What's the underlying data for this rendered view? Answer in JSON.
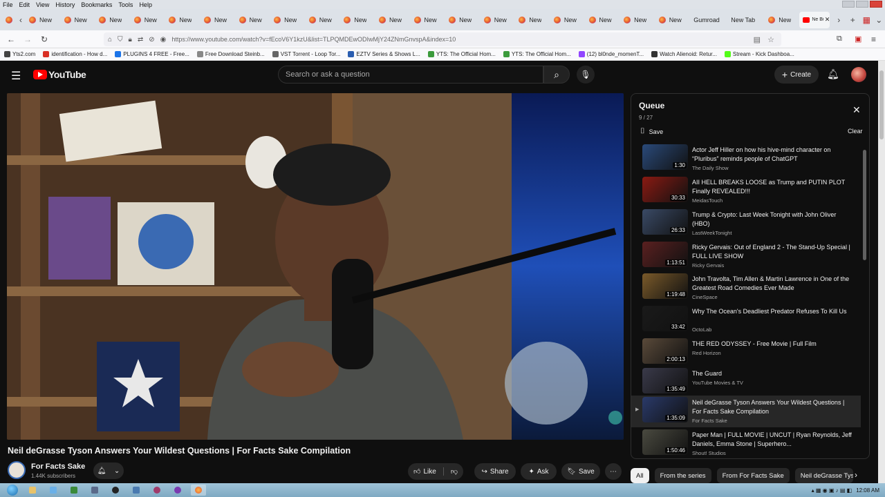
{
  "browser": {
    "menus": [
      "File",
      "Edit",
      "View",
      "History",
      "Bookmarks",
      "Tools",
      "Help"
    ],
    "new_tab_label": "New",
    "tabs_left_count": 22,
    "extra_tabs": [
      "Gumroad",
      "New Tab",
      "New"
    ],
    "active_tab_label": "Ne Bu",
    "url": "https://www.youtube.com/watch?v=fEcoV6Y1kzU&list=TLPQMDEwODIwMjY24ZNmGnvspA&index=10",
    "bookmarks": [
      {
        "label": "Yts2.com",
        "color": "#444"
      },
      {
        "label": "identification - How d...",
        "color": "#d93025"
      },
      {
        "label": "PLUGINS 4 FREE - Free...",
        "color": "#1a73e8"
      },
      {
        "label": "Free Download Steinb...",
        "color": "#888"
      },
      {
        "label": "VST Torrent - Loop Tor...",
        "color": "#666"
      },
      {
        "label": "EZTV Series & Shows L...",
        "color": "#2a5db0"
      },
      {
        "label": "YTS: The Official Hom...",
        "color": "#3c9b3c"
      },
      {
        "label": "YTS: The Official Hom...",
        "color": "#3c9b3c"
      },
      {
        "label": "(12) bl0nde_momenT...",
        "color": "#9146ff"
      },
      {
        "label": "Watch Alienoid: Retur...",
        "color": "#333"
      },
      {
        "label": "Stream - Kick Dashboa...",
        "color": "#53fc18"
      }
    ]
  },
  "header": {
    "logo_text": "YouTube",
    "search_placeholder": "Search or ask a question",
    "create_label": "Create"
  },
  "video": {
    "title": "Neil deGrasse Tyson Answers Your Wildest Questions | For Facts Sake Compilation",
    "channel": "For Facts Sake",
    "subscribers": "1.44K subscribers"
  },
  "actions": {
    "like": "Like",
    "share": "Share",
    "ask": "Ask",
    "save": "Save"
  },
  "queue": {
    "title": "Queue",
    "position": "9 / 27",
    "save_label": "Save",
    "clear_label": "Clear",
    "items": [
      {
        "title": "Actor Jeff Hiller on how his hive-mind character on “Pluribus” reminds people of ChatGPT",
        "channel": "The Daily Show",
        "duration": "1:30",
        "thumb": "#2a4a7a"
      },
      {
        "title": "AII HELL BREAKS LOOSE as Trump and PUTIN PLOT Finally REVEALED!!!",
        "channel": "MeidasTouch",
        "duration": "30:33",
        "thumb": "#8a1a12"
      },
      {
        "title": "Trump & Crypto: Last Week Tonight with John Oliver (HBO)",
        "channel": "LastWeekTonight",
        "duration": "26:33",
        "thumb": "#3a4a66"
      },
      {
        "title": "Ricky Gervais: Out of England 2 - The Stand-Up Special | FULL LIVE SHOW",
        "channel": "Ricky Gervais",
        "duration": "1:13:51",
        "thumb": "#5a2020"
      },
      {
        "title": "John Travolta, Tim Allen & Martin Lawrence in One of the Greatest Road Comedies Ever Made",
        "channel": "CineSpace",
        "duration": "1:19:48",
        "thumb": "#7a5a2a"
      },
      {
        "title": "Why The Ocean's Deadliest Predator Refuses To Kill Us",
        "channel": "OctoLab",
        "duration": "33:42",
        "thumb": "#1a1a1a"
      },
      {
        "title": "THE RED ODYSSEY - Free Movie | Full Film",
        "channel": "Red Horizon",
        "duration": "2:00:13",
        "thumb": "#5a4a3a"
      },
      {
        "title": "The Guard",
        "channel": "YouTube Movies & TV",
        "duration": "1:35:49",
        "thumb": "#3a3a4a"
      },
      {
        "title": "Neil deGrasse Tyson Answers Your Wildest Questions | For Facts Sake Compilation",
        "channel": "For Facts Sake",
        "duration": "1:35:09",
        "thumb": "#2a3a6a",
        "current": true
      },
      {
        "title": "Paper Man | FULL MOVIE | UNCUT | Ryan Reynolds, Jeff Daniels, Emma Stone | Superhero...",
        "channel": "Shout! Studios",
        "duration": "1:50:46",
        "thumb": "#4a4a40"
      }
    ]
  },
  "chips": [
    "All",
    "From the series",
    "From For Facts Sake",
    "Neil deGrasse Tys"
  ],
  "taskbar": {
    "time": "12:08 AM"
  }
}
